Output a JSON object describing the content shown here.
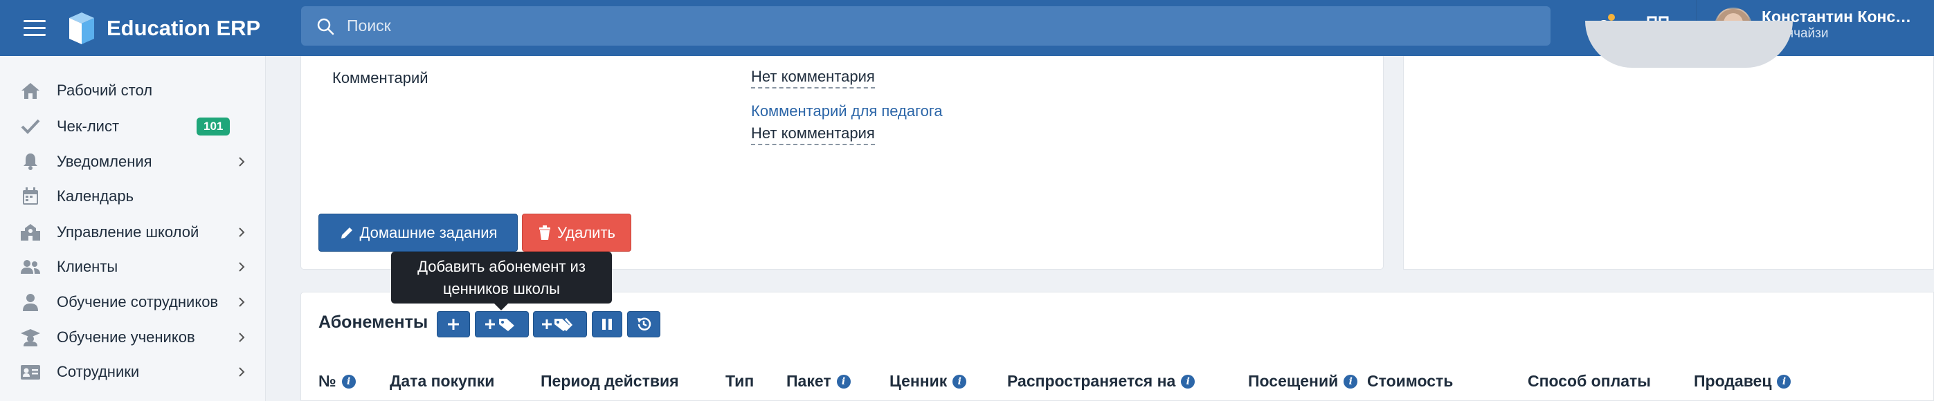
{
  "app": {
    "title": "Education ERP"
  },
  "search": {
    "placeholder": "Поиск"
  },
  "user": {
    "name": "Константин Конс…",
    "role": "Франчайзи"
  },
  "sidebar": {
    "items": [
      {
        "label": "Рабочий стол",
        "icon": "home-icon"
      },
      {
        "label": "Чек-лист",
        "icon": "check-icon",
        "badge": "101"
      },
      {
        "label": "Уведомления",
        "icon": "bell-icon"
      },
      {
        "label": "Календарь",
        "icon": "calendar-icon"
      },
      {
        "label": "Управление школой",
        "icon": "school-icon"
      },
      {
        "label": "Клиенты",
        "icon": "users-icon"
      },
      {
        "label": "Обучение сотрудников",
        "icon": "teacher-icon"
      },
      {
        "label": "Обучение учеников",
        "icon": "graduation-icon"
      },
      {
        "label": "Сотрудники",
        "icon": "id-card-icon"
      }
    ]
  },
  "lesson": {
    "comment_label": "Комментарий",
    "comment_value": "Нет комментария",
    "teacher_comment_link": "Комментарий для педагога",
    "teacher_comment_value": "Нет комментария",
    "homework_button": "Домашние задания",
    "delete_button": "Удалить"
  },
  "tooltip": {
    "line1": "Добавить абонемент из",
    "line2": "ценников школы"
  },
  "subscriptions": {
    "title": "Абонементы",
    "columns": [
      "№",
      "Дата покупки",
      "Период действия",
      "Тип",
      "Пакет",
      "Ценник",
      "Распространяется на",
      "Посещений",
      "Стоимость",
      "Способ оплаты",
      "Продавец"
    ]
  },
  "colors": {
    "primary": "#2c66a8",
    "danger": "#e8574c",
    "badge": "#1fa67a",
    "tooltip": "#1f232a"
  }
}
